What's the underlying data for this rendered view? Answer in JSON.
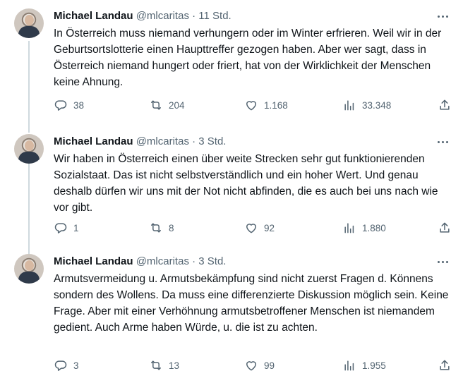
{
  "tweets": [
    {
      "author_name": "Michael Landau",
      "handle": "@mlcaritas",
      "separator": "·",
      "time": "11 Std.",
      "text": "In Österreich muss niemand verhungern oder im Winter erfrieren. Weil wir in der Geburtsortslotterie einen Haupttreffer gezogen haben. Aber wer sagt, dass in Österreich niemand hungert oder friert, hat von der Wirklichkeit der Menschen keine Ahnung.",
      "replies": "38",
      "retweets": "204",
      "likes": "1.168",
      "views": "33.348"
    },
    {
      "author_name": "Michael Landau",
      "handle": "@mlcaritas",
      "separator": "·",
      "time": "3 Std.",
      "text": "Wir haben in Österreich einen über weite Strecken sehr gut funktionierenden Sozialstaat. Das ist nicht selbstverständlich und ein hoher Wert. Und genau deshalb dürfen wir uns mit der Not nicht abfinden, die es auch bei uns nach wie vor gibt.",
      "replies": "1",
      "retweets": "8",
      "likes": "92",
      "views": "1.880"
    },
    {
      "author_name": "Michael Landau",
      "handle": "@mlcaritas",
      "separator": "·",
      "time": "3 Std.",
      "text": "Armutsvermeidung u. Armutsbekämpfung sind nicht zuerst Fragen d. Könnens sondern des Wollens. Da muss eine differenzierte Diskussion möglich sein. Keine Frage. Aber mit einer Verhöhnung armutsbetroffener Menschen ist niemandem gedient. Auch Arme haben Würde, u. die ist zu achten.",
      "replies": "3",
      "retweets": "13",
      "likes": "99",
      "views": "1.955"
    }
  ],
  "icons": {
    "reply": "reply-icon",
    "retweet": "retweet-icon",
    "like": "heart-icon",
    "views": "views-icon",
    "share": "share-icon",
    "more": "more-icon"
  },
  "colors": {
    "text": "#0f1419",
    "secondary": "#536471",
    "thread_line": "#cfd9de"
  }
}
